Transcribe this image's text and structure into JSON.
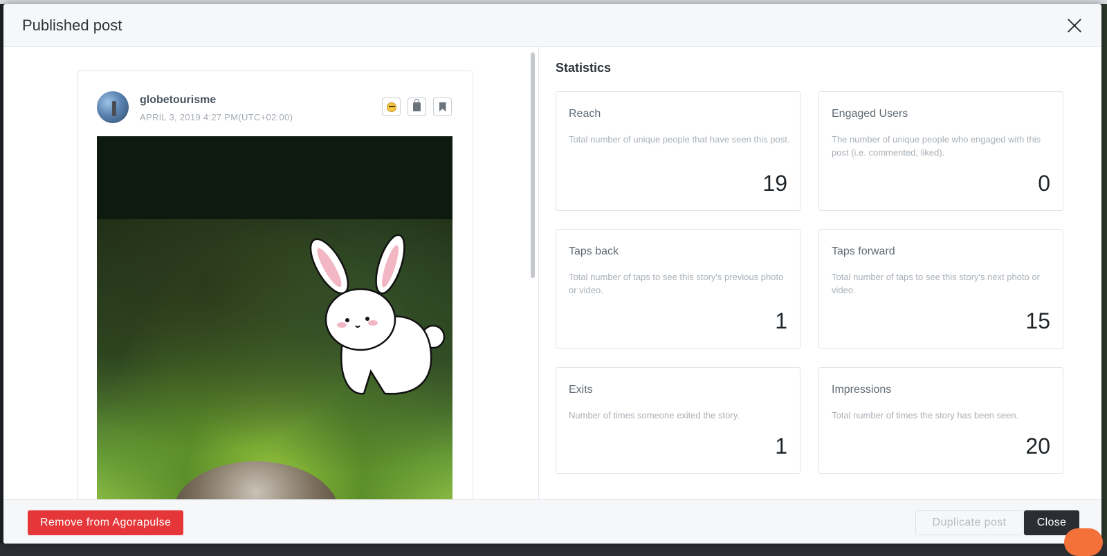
{
  "modal": {
    "title": "Published post"
  },
  "post": {
    "username": "globetourisme",
    "date": "APRIL 3, 2019 4:27 PM(UTC+02:00)",
    "icons": [
      "emoji-icon",
      "lock-icon",
      "bookmark-icon"
    ]
  },
  "statistics": {
    "title": "Statistics",
    "cards": [
      {
        "name": "Reach",
        "description": "Total number of unique people that have seen this post.",
        "value": "19"
      },
      {
        "name": "Engaged Users",
        "description": "The number of unique people who engaged with this post (i.e. commented, liked).",
        "value": "0"
      },
      {
        "name": "Taps back",
        "description": "Total number of taps to see this story's previous photo or video.",
        "value": "1"
      },
      {
        "name": "Taps forward",
        "description": "Total number of taps to see this story's next photo or video.",
        "value": "15"
      },
      {
        "name": "Exits",
        "description": "Number of times someone exited the story.",
        "value": "1"
      },
      {
        "name": "Impressions",
        "description": "Total number of times the story has been seen.",
        "value": "20"
      }
    ]
  },
  "footer": {
    "remove_label": "Remove from Agorapulse",
    "duplicate_label": "Duplicate post",
    "close_label": "Close"
  },
  "colors": {
    "danger": "#e5373a",
    "dark": "#2a2e33"
  }
}
